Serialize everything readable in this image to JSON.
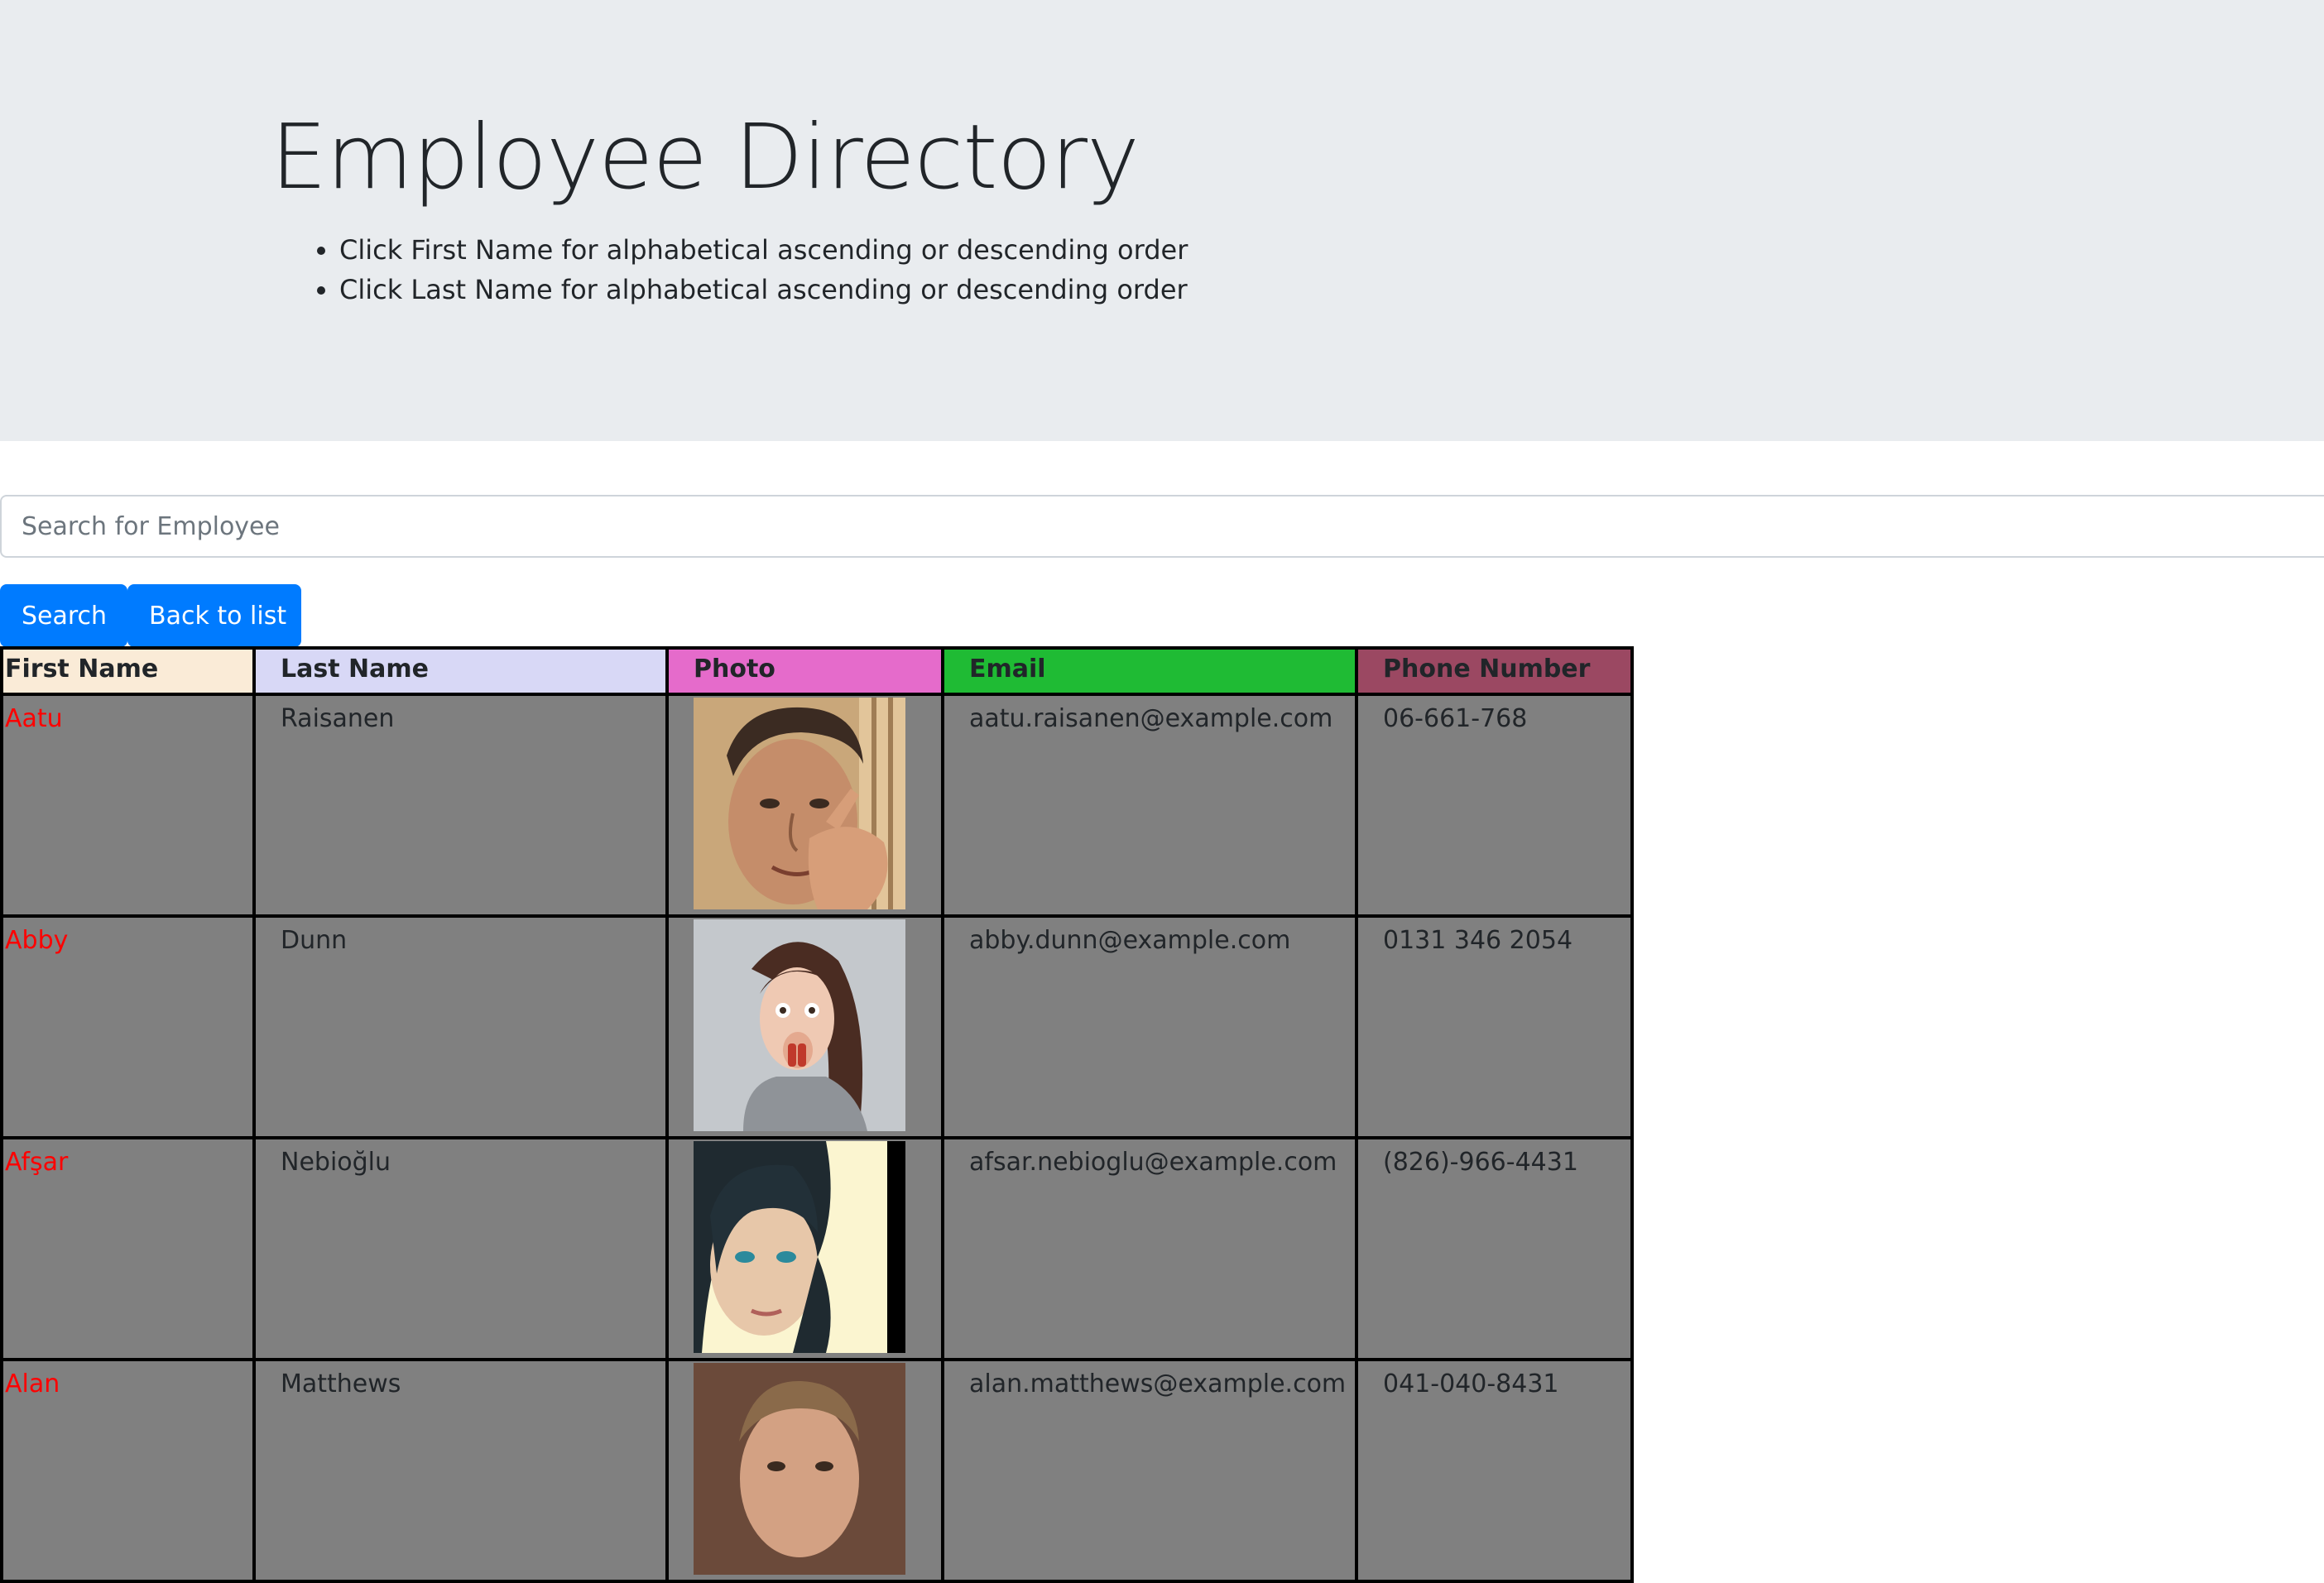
{
  "header": {
    "title": "Employee Directory",
    "instructions": [
      "Click First Name for alphabetical ascending or descending order",
      "Click Last Name for alphabetical ascending or descending order"
    ]
  },
  "search": {
    "placeholder": "Search for Employee",
    "value": "",
    "search_button_label": "Search",
    "back_button_label": "Back to list",
    "button_color": "#007bff"
  },
  "table": {
    "columns": [
      {
        "label": "First Name",
        "color": "#faebd7"
      },
      {
        "label": "Last Name",
        "color": "#d8d8f6"
      },
      {
        "label": "Photo",
        "color": "#e56bcb"
      },
      {
        "label": "Email",
        "color": "#1fbb34"
      },
      {
        "label": "Phone Number",
        "color": "#9b4862"
      }
    ],
    "row_background": "#808080",
    "first_name_color": "#ff0000",
    "rows": [
      {
        "first": "Aatu",
        "last": "Raisanen",
        "photo": "man-with-hand-on-face-photo",
        "email": "aatu.raisanen@example.com",
        "phone": "06-661-768"
      },
      {
        "first": "Abby",
        "last": "Dunn",
        "photo": "surprised-woman-photo",
        "email": "abby.dunn@example.com",
        "phone": "0131 346 2054"
      },
      {
        "first": "Afşar",
        "last": "Nebioğlu",
        "photo": "woman-selfie-photo",
        "email": "afsar.nebioglu@example.com",
        "phone": "(826)-966-4431"
      },
      {
        "first": "Alan",
        "last": "Matthews",
        "photo": "man-portrait-photo",
        "email": "alan.matthews@example.com",
        "phone": "041-040-8431"
      }
    ]
  }
}
